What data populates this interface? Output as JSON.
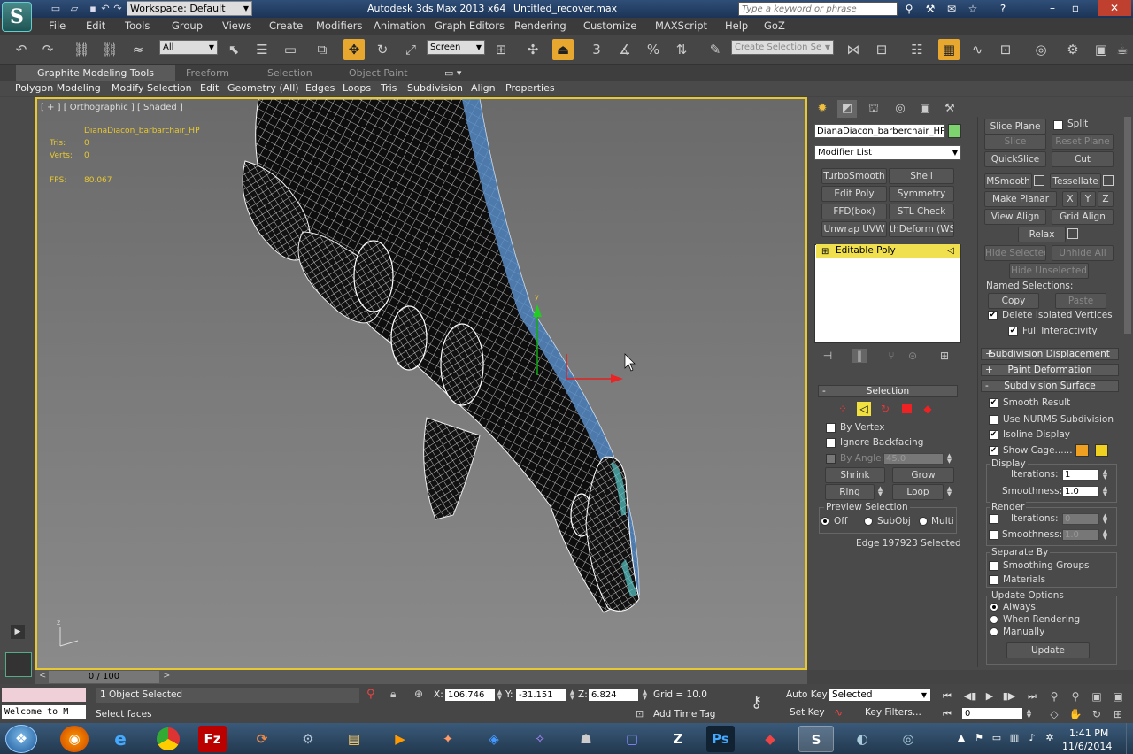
{
  "titlebar": {
    "workspace": "Workspace: Default",
    "app_title": "Autodesk 3ds Max  2013 x64",
    "file_name": "Untitled_recover.max",
    "search_placeholder": "Type a keyword or phrase"
  },
  "menu": [
    "File",
    "Edit",
    "Tools",
    "Group",
    "Views",
    "Create",
    "Modifiers",
    "Animation",
    "Graph Editors",
    "Rendering",
    "Customize",
    "MAXScript",
    "Help",
    "GoZ"
  ],
  "toolbar": {
    "filter_select": "All",
    "coord_system": "Screen",
    "named_selection_placeholder": "Create Selection Se"
  },
  "ribbon": {
    "tabs": [
      "Graphite Modeling Tools",
      "Freeform",
      "Selection",
      "Object Paint"
    ],
    "sub": [
      "Polygon Modeling",
      "Modify Selection",
      "Edit",
      "Geometry (All)",
      "Edges",
      "Loops",
      "Tris",
      "Subdivision",
      "Align",
      "Properties"
    ]
  },
  "viewport": {
    "label": "[ + ] [ Orthographic ] [ Shaded ]",
    "object_name": "DianaDiacon_barbarchair_HP",
    "tris_label": "Tris:",
    "tris_value": "0",
    "verts_label": "Verts:",
    "verts_value": "0",
    "fps_label": "FPS:",
    "fps_value": "80.067",
    "axis_y": "y",
    "axis_z": "z"
  },
  "command_panel": {
    "object_name": "DianaDiacon_barberchair_HP",
    "modifier_list": "Modifier List",
    "modifier_buttons": [
      "TurboSmooth",
      "Shell",
      "Edit Poly",
      "Symmetry",
      "FFD(box)",
      "STL Check",
      "Unwrap UVW",
      "thDeform (WSI"
    ],
    "stack_item": "Editable Poly",
    "selection": {
      "title": "Selection",
      "by_vertex": "By Vertex",
      "ignore_backfacing": "Ignore Backfacing",
      "by_angle": "By Angle:",
      "by_angle_value": "45.0",
      "shrink": "Shrink",
      "grow": "Grow",
      "ring": "Ring",
      "loop": "Loop",
      "preview_title": "Preview Selection",
      "preview_off": "Off",
      "preview_subobj": "SubObj",
      "preview_multi": "Multi",
      "status": "Edge 197923 Selected"
    }
  },
  "right_panel": {
    "slice_plane": "Slice Plane",
    "split": "Split",
    "slice": "Slice",
    "reset_plane": "Reset Plane",
    "quickslice": "QuickSlice",
    "cut": "Cut",
    "msmooth": "MSmooth",
    "tessellate": "Tessellate",
    "make_planar": "Make Planar",
    "x": "X",
    "y": "Y",
    "z": "Z",
    "view_align": "View Align",
    "grid_align": "Grid Align",
    "relax": "Relax",
    "hide_selected": "Hide Selected",
    "unhide_all": "Unhide All",
    "hide_unselected": "Hide Unselected",
    "named_selections": "Named Selections:",
    "copy": "Copy",
    "paste": "Paste",
    "delete_isolated": "Delete Isolated Vertices",
    "full_interactivity": "Full Interactivity",
    "subdiv_displacement": "Subdivision Displacement",
    "paint_deformation": "Paint Deformation",
    "subdiv_surface": "Subdivision Surface",
    "smooth_result": "Smooth Result",
    "use_nurms": "Use NURMS Subdivision",
    "isoline_display": "Isoline Display",
    "show_cage": "Show Cage......",
    "display": "Display",
    "iterations": "Iterations:",
    "display_iterations": "1",
    "smoothness": "Smoothness:",
    "display_smoothness": "1.0",
    "render": "Render",
    "render_iterations": "0",
    "render_smoothness": "1.0",
    "separate_by": "Separate By",
    "smoothing_groups": "Smoothing Groups",
    "materials": "Materials",
    "update_options": "Update Options",
    "always": "Always",
    "when_rendering": "When Rendering",
    "manually": "Manually",
    "update": "Update",
    "cage_color_1": "#f0a020",
    "cage_color_2": "#f0d020"
  },
  "bottom": {
    "time_slider": "0 / 100",
    "welcome": "Welcome to M",
    "status1": "1 Object Selected",
    "status2": "Select faces",
    "x_label": "X:",
    "x_value": "106.746",
    "y_label": "Y:",
    "y_value": "-31.151",
    "z_label": "Z:",
    "z_value": "6.824",
    "grid": "Grid = 10.0",
    "add_time_tag": "Add Time Tag",
    "auto_key": "Auto Key",
    "selected": "Selected",
    "set_key": "Set Key",
    "key_filters": "Key Filters...",
    "frame": "0"
  },
  "taskbar": {
    "time": "1:41 PM",
    "date": "11/6/2014"
  }
}
